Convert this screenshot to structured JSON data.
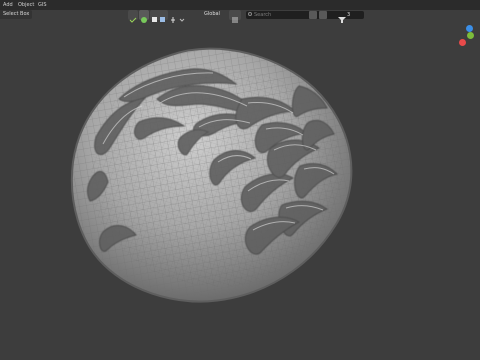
{
  "menu": {
    "add": "Add",
    "object": "Object",
    "gis": "GIS"
  },
  "header": {
    "select_mode": "Select Box",
    "pivot": "Global",
    "search_placeholder": "Search",
    "count": "3"
  },
  "icons": {
    "view": "view-icon",
    "sphere": "sphere-icon",
    "check": "check-icon",
    "filter": "filter-icon",
    "cursor": "cursor-icon",
    "grid": "grid-icon"
  },
  "gizmo": {
    "x_color": "#e94a4a",
    "y_color": "#7cbc3b",
    "z_color": "#3b8fe8",
    "x_label": "",
    "y_label": "",
    "z_label": ""
  },
  "colors": {
    "background": "#3d3d3d",
    "panel": "#2b2b2b",
    "mesh": "#9a9a9a",
    "mesh_dark": "#626262",
    "mesh_light": "#c8c8c8",
    "accent": "#3b8fe8"
  }
}
